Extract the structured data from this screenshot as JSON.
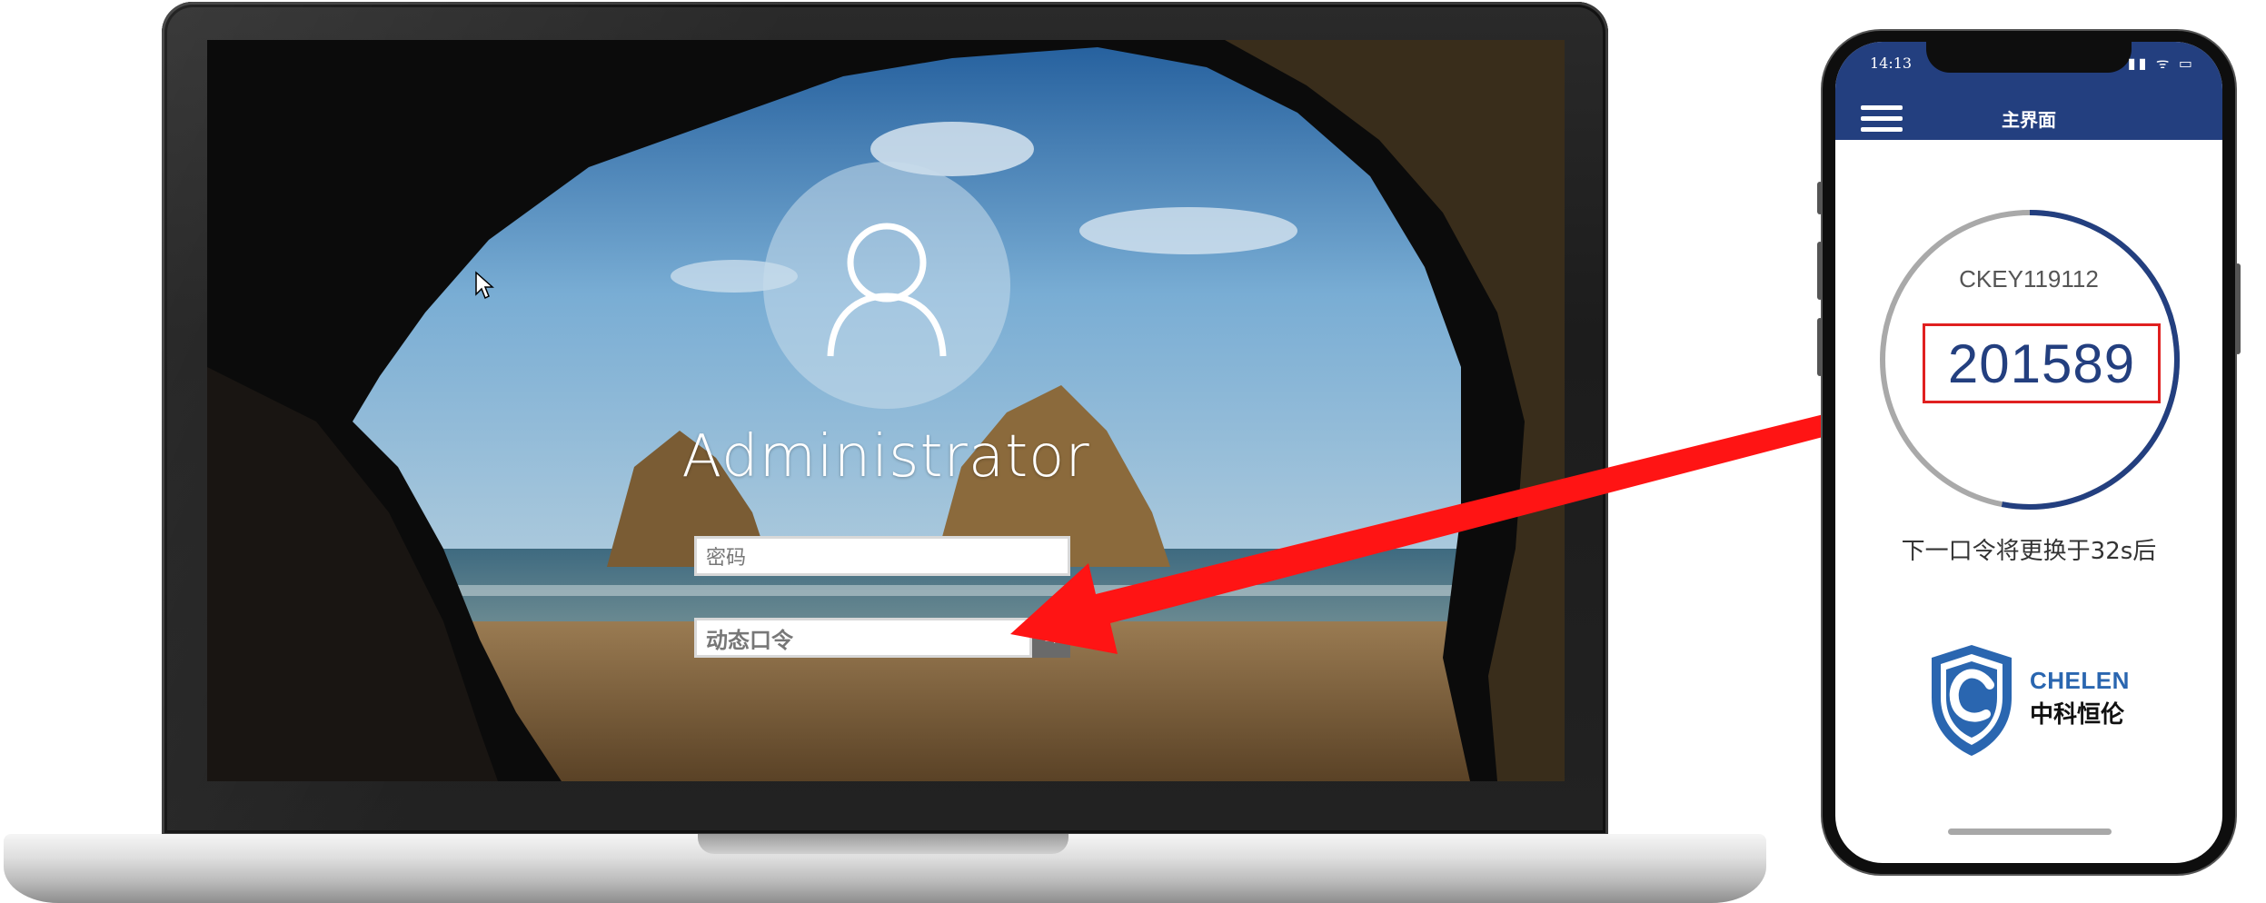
{
  "login_screen": {
    "username": "Administrator",
    "password_placeholder": "密码",
    "otp_placeholder": "动态口令",
    "submit_glyph": "→"
  },
  "phone_app": {
    "status_time": "14:13",
    "status_icons": "▮▮ ᯤ ▭",
    "nav_title": "主界面",
    "token_id": "CKEY119112",
    "otp_code": "201589",
    "countdown_text": "下一口令将更换于32s后",
    "countdown_fraction_remaining": 0.53,
    "brand_name_en": "CHELEN",
    "brand_name_cn": "中科恒伦"
  },
  "colors": {
    "app_header": "#233f7f",
    "ring_active": "#233f7f",
    "ring_track": "#a9a9a9",
    "highlight_red": "#e02020",
    "arrow_red": "#ff1414",
    "brand_blue": "#2a66b0"
  },
  "icons": {
    "user": "user-silhouette-icon",
    "menu": "hamburger-menu-icon",
    "logo": "shield-c-logo-icon",
    "cursor": "mouse-pointer-icon",
    "submit": "arrow-right-icon"
  }
}
